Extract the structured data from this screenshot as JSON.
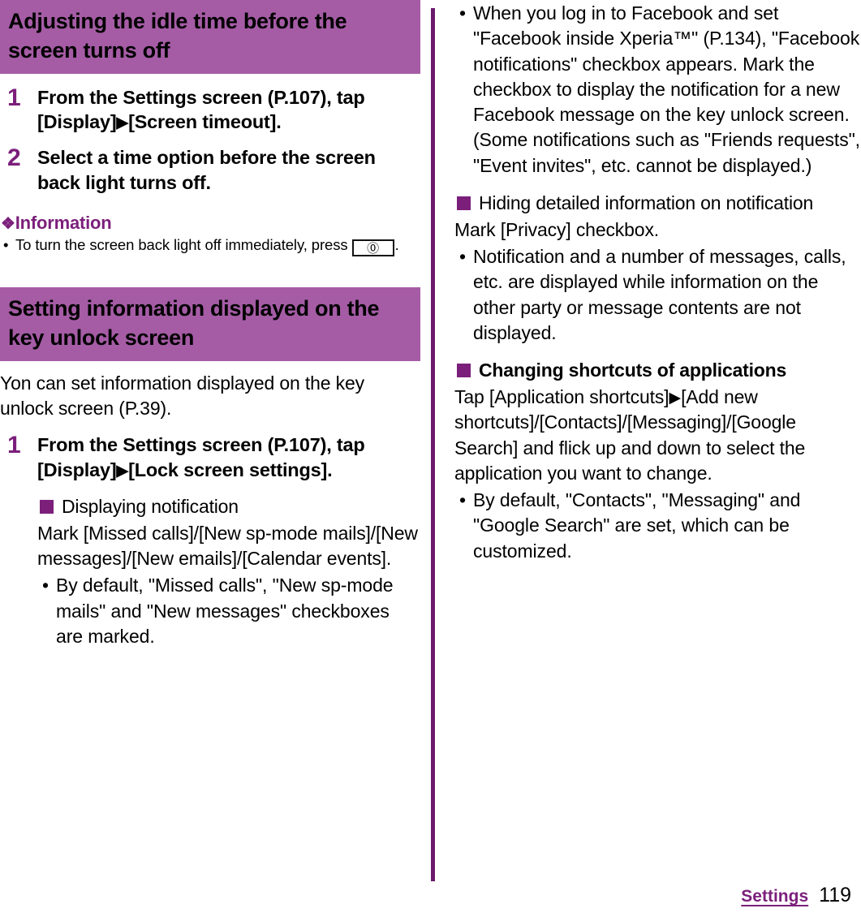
{
  "page": {
    "number": "119",
    "footer_label": "Settings"
  },
  "colors": {
    "heading_band": "#a55ca5",
    "accent_purple": "#7b1f7b",
    "divider": "#6b1a6b"
  },
  "left_column": {
    "section1": {
      "heading": "Adjusting the idle time before the screen turns off",
      "steps": [
        {
          "number": "1",
          "text_before": "From the Settings screen (P.107), tap [Display]",
          "arrow": "▶",
          "text_after": "[Screen timeout]."
        },
        {
          "number": "2",
          "text_before": "Select a time option before the screen back light turns off.",
          "arrow": "",
          "text_after": ""
        }
      ],
      "information": {
        "ornament": "❖",
        "title": "Information",
        "bullet_before": "To turn the screen back light off immediately, press",
        "key_glyph": "⓪",
        "bullet_after": "."
      }
    },
    "section2": {
      "heading": "Setting information displayed on the key unlock screen",
      "intro": "Yon can set information displayed on the key unlock screen (P.39).",
      "step": {
        "number": "1",
        "text_before": "From the Settings screen (P.107), tap [Display]",
        "arrow": "▶",
        "text_after": "[Lock screen settings]."
      },
      "subsection": {
        "heading": "Displaying notification",
        "body": "Mark [Missed calls]/[New sp-mode mails]/[New messages]/[New emails]/[Calendar events].",
        "bullets": [
          "By default, \"Missed calls\", \"New sp-mode mails\" and \"New messages\" checkboxes are marked."
        ]
      }
    }
  },
  "right_column": {
    "continued_bullets": [
      "When you log in to Facebook and set \"Facebook inside Xperia™\" (P.134), \"Facebook notifications\" checkbox appears. Mark the checkbox to display the notification for a new Facebook message on the key unlock screen. (Some notifications such as \"Friends requests\", \"Event invites\", etc. cannot be displayed.)"
    ],
    "subsection1": {
      "heading": "Hiding detailed information on notification",
      "body": "Mark [Privacy] checkbox.",
      "bullets": [
        "Notification and a number of messages, calls, etc. are displayed while information on the other party or message contents are not displayed."
      ]
    },
    "subsection2": {
      "heading": "Changing shortcuts of applications",
      "body_before": "Tap [Application shortcuts]",
      "arrow": "▶",
      "body_after": "[Add new shortcuts]/[Contacts]/[Messaging]/[Google Search] and flick up and down to select the application you want to change.",
      "bullets": [
        "By default, \"Contacts\", \"Messaging\" and \"Google Search\" are set, which can be customized."
      ]
    }
  }
}
